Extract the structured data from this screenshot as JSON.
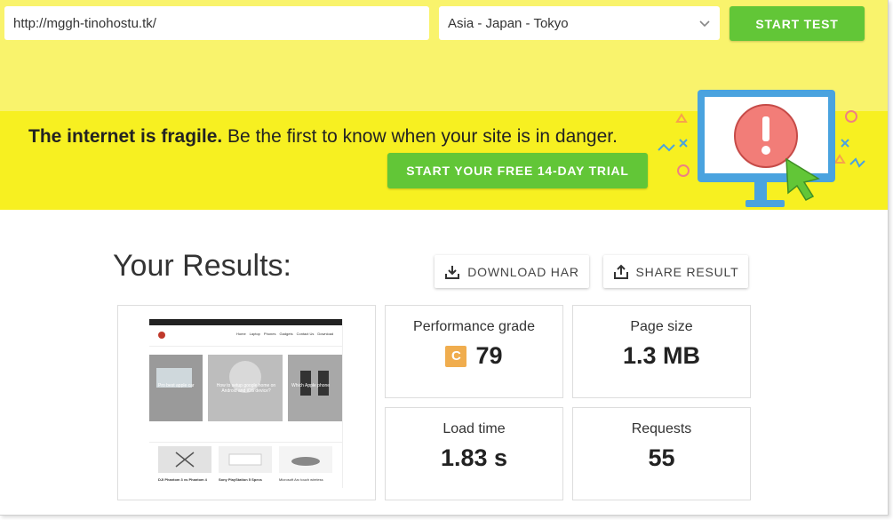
{
  "test_form": {
    "url_value": "http://mggh-tinohostu.tk/",
    "location_selected": "Asia - Japan - Tokyo",
    "start_label": "START TEST"
  },
  "banner": {
    "headline_bold": "The internet is fragile.",
    "headline_rest": " Be the first to know when your site is in danger.",
    "trial_label": "START YOUR FREE 14-DAY TRIAL"
  },
  "results": {
    "title": "Your Results:",
    "download_label": "DOWNLOAD HAR",
    "share_label": "SHARE RESULT",
    "performance": {
      "label": "Performance grade",
      "grade": "C",
      "score": "79"
    },
    "page_size": {
      "label": "Page size",
      "value": "1.3 MB"
    },
    "load_time": {
      "label": "Load time",
      "value": "1.83 s"
    },
    "requests": {
      "label": "Requests",
      "value": "55"
    }
  },
  "screenshot_preview": {
    "nav_items": [
      "Home",
      "Laptop",
      "Phones",
      "Gadgets",
      "Contact Us",
      "Download"
    ],
    "featured_captions": [
      "Pro best apple car",
      "How to setup google home on Android and iOS device?",
      "Which Apple phone"
    ],
    "product_captions": [
      "DJI Phantom 3 vs Phantom 4",
      "Sony PlayStation 5 Specs",
      "Microsoft Arc touch wireless"
    ]
  },
  "colors": {
    "top_yellow": "#f9f36c",
    "banner_yellow": "#f7f021",
    "accent_green": "#62c637",
    "grade_c": "#f0ad4e"
  }
}
